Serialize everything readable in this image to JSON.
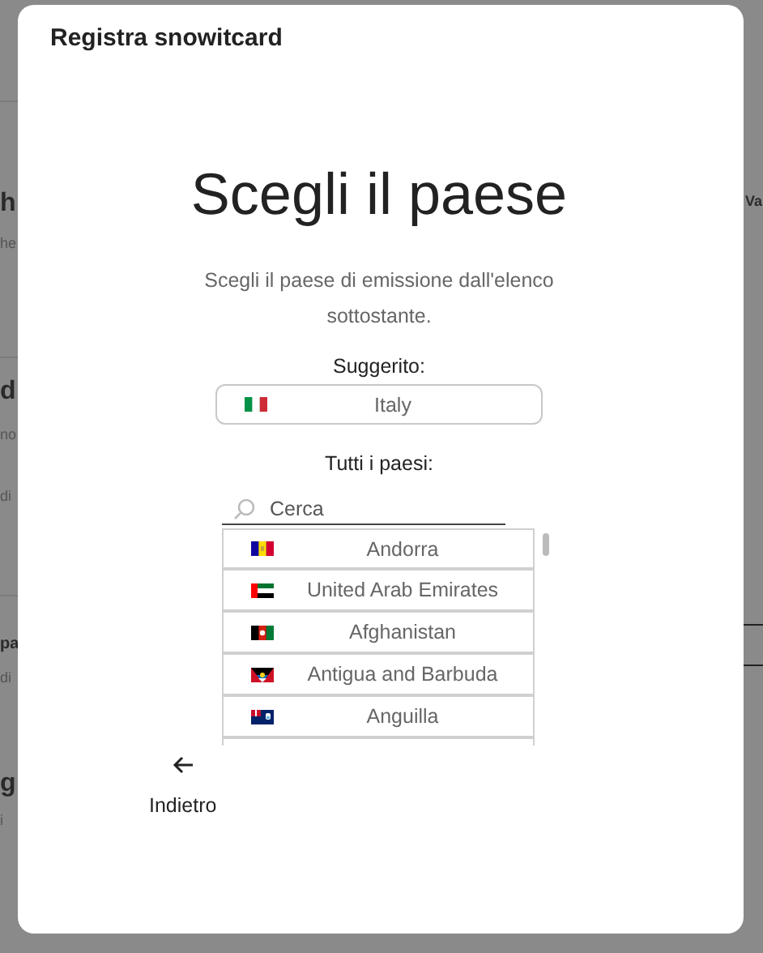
{
  "background": {
    "left_fragments": [
      {
        "text": "h",
        "kind": "heading"
      },
      {
        "text": "he",
        "kind": "sub"
      },
      {
        "text": "d",
        "kind": "heading"
      },
      {
        "text": "no",
        "kind": "sub"
      },
      {
        "text": "di",
        "kind": "sub"
      },
      {
        "text": "pa",
        "kind": "heading"
      },
      {
        "text": "di",
        "kind": "sub"
      },
      {
        "text": "g",
        "kind": "heading"
      },
      {
        "text": "i",
        "kind": "sub"
      }
    ],
    "right_fragments": [
      {
        "text": "Va",
        "kind": "label"
      }
    ]
  },
  "dialog": {
    "title": "Registra snowitcard",
    "heading": "Scegli il paese",
    "description": "Scegli il paese di emissione dall'elenco sottostante.",
    "suggested": {
      "label": "Suggerito:",
      "country": "Italy"
    },
    "all": {
      "label": "Tutti i paesi:",
      "search": {
        "placeholder": "Cerca"
      },
      "countries": [
        {
          "name": "Andorra"
        },
        {
          "name": "United Arab Emirates"
        },
        {
          "name": "Afghanistan"
        },
        {
          "name": "Antigua and Barbuda"
        },
        {
          "name": "Anguilla"
        }
      ]
    },
    "back": {
      "label": "Indietro"
    }
  }
}
